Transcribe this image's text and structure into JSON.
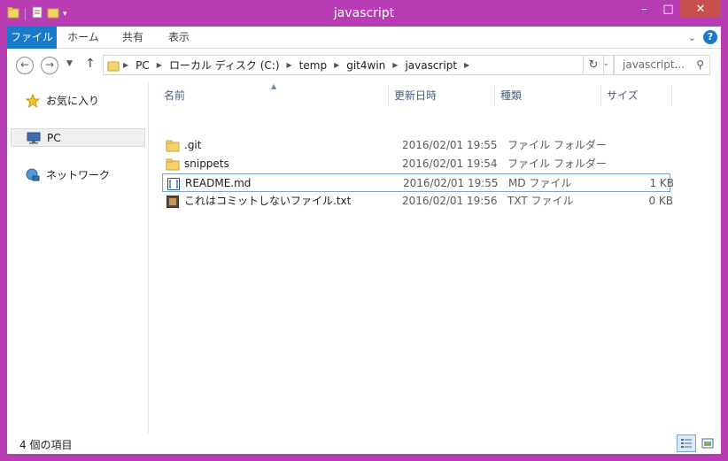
{
  "window": {
    "title": "javascript",
    "accent_color": "#b83cb3",
    "controls": {
      "minimize": "–",
      "maximize": "□",
      "close": "✕"
    }
  },
  "ribbon": {
    "tabs": [
      {
        "label": "ファイル",
        "active": true
      },
      {
        "label": "ホーム"
      },
      {
        "label": "共有"
      },
      {
        "label": "表示"
      }
    ]
  },
  "address_bar": {
    "breadcrumbs": [
      "PC",
      "ローカル ディスク (C:)",
      "temp",
      "git4win",
      "javascript"
    ]
  },
  "search": {
    "placeholder": "javascript..."
  },
  "nav_pane": {
    "items": [
      {
        "label": "お気に入り",
        "icon": "star-icon"
      },
      {
        "label": "PC",
        "icon": "computer-icon",
        "selected": true
      },
      {
        "label": "ネットワーク",
        "icon": "network-icon"
      }
    ]
  },
  "columns": [
    "名前",
    "更新日時",
    "種類",
    "サイズ"
  ],
  "files": [
    {
      "name": ".git",
      "date": "2016/02/01 19:55",
      "kind": "ファイル フォルダー",
      "size": "",
      "icon": "folder-icon"
    },
    {
      "name": "snippets",
      "date": "2016/02/01 19:54",
      "kind": "ファイル フォルダー",
      "size": "",
      "icon": "folder-icon"
    },
    {
      "name": "README.md",
      "date": "2016/02/01 19:55",
      "kind": "MD ファイル",
      "size": "1 KB",
      "icon": "md-file-icon",
      "focused": true
    },
    {
      "name": "これはコミットしないファイル.txt",
      "date": "2016/02/01 19:56",
      "kind": "TXT ファイル",
      "size": "0 KB",
      "icon": "txt-file-icon"
    }
  ],
  "status": {
    "item_count": "4 個の項目"
  }
}
